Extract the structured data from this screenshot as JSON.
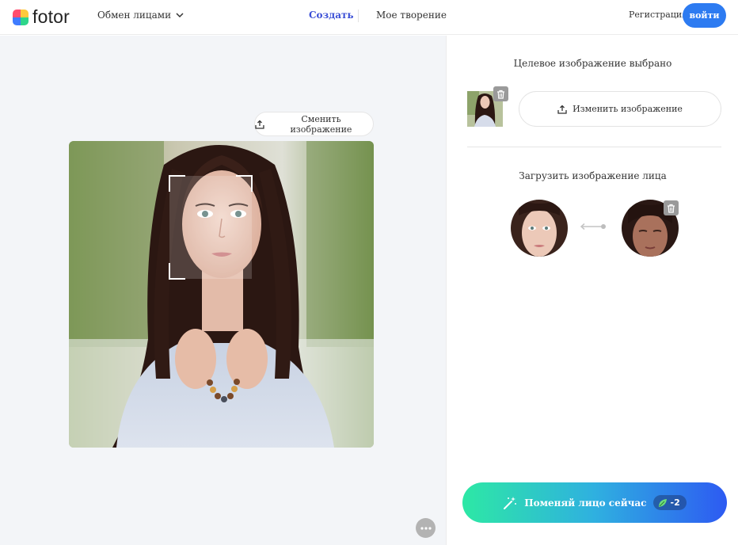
{
  "brand": {
    "name": "fotor"
  },
  "header": {
    "tool_menu": "Обмен лицами",
    "nav_create": "Создать",
    "nav_works": "Мое творение",
    "register": "Регистрация",
    "login": "войти"
  },
  "workspace": {
    "change_image": "Сменить изображение"
  },
  "panel": {
    "target_title": "Целевое изображение выбрано",
    "change_target": "Изменить изображение",
    "upload_title": "Загрузить изображение лица",
    "swap_button": "Поменяй лицо сейчас",
    "credit_cost": "-2"
  },
  "colors": {
    "accent": "#2d7bf1",
    "nav_active": "#3b4fd6",
    "gradient_start": "#2de8a5",
    "gradient_end": "#2d5af2"
  },
  "icons": [
    "chevron-down-icon",
    "upload-icon",
    "trash-icon",
    "link-icon",
    "magic-wand-icon",
    "leaf-icon",
    "more-icon"
  ]
}
